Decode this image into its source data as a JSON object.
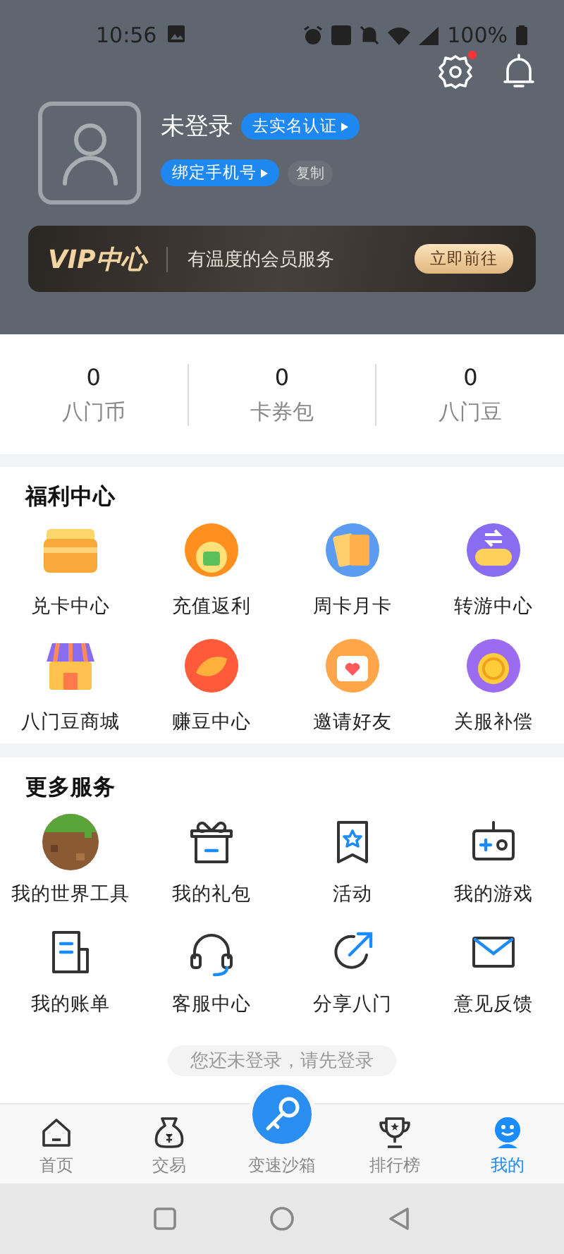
{
  "status_bar": {
    "time": "10:56",
    "battery": "100%"
  },
  "top_actions": {
    "settings_badge": true
  },
  "profile": {
    "name": "未登录",
    "verify_button": "去实名认证",
    "bind_phone_button": "绑定手机号",
    "copy_button": "复制"
  },
  "vip_banner": {
    "title": "VIP中心",
    "slogan": "有温度的会员服务",
    "button": "立即前往"
  },
  "stats": [
    {
      "value": "0",
      "label": "八门币"
    },
    {
      "value": "0",
      "label": "卡券包"
    },
    {
      "value": "0",
      "label": "八门豆"
    }
  ],
  "welfare": {
    "title": "福利中心",
    "items": [
      {
        "label": "兑卡中心"
      },
      {
        "label": "充值返利"
      },
      {
        "label": "周卡月卡"
      },
      {
        "label": "转游中心"
      },
      {
        "label": "八门豆商城"
      },
      {
        "label": "赚豆中心"
      },
      {
        "label": "邀请好友"
      },
      {
        "label": "关服补偿"
      }
    ]
  },
  "services": {
    "title": "更多服务",
    "items": [
      {
        "label": "我的世界工具"
      },
      {
        "label": "我的礼包"
      },
      {
        "label": "活动"
      },
      {
        "label": "我的游戏"
      },
      {
        "label": "我的账单"
      },
      {
        "label": "客服中心"
      },
      {
        "label": "分享八门"
      },
      {
        "label": "意见反馈"
      }
    ]
  },
  "toast": "您还未登录，请先登录",
  "tabs": [
    {
      "label": "首页",
      "kind": "tab",
      "selected": false
    },
    {
      "label": "交易",
      "kind": "tab",
      "selected": false
    },
    {
      "label": "变速沙箱",
      "kind": "center",
      "selected": false
    },
    {
      "label": "排行榜",
      "kind": "tab",
      "selected": false
    },
    {
      "label": "我的",
      "kind": "tab",
      "selected": true
    }
  ]
}
